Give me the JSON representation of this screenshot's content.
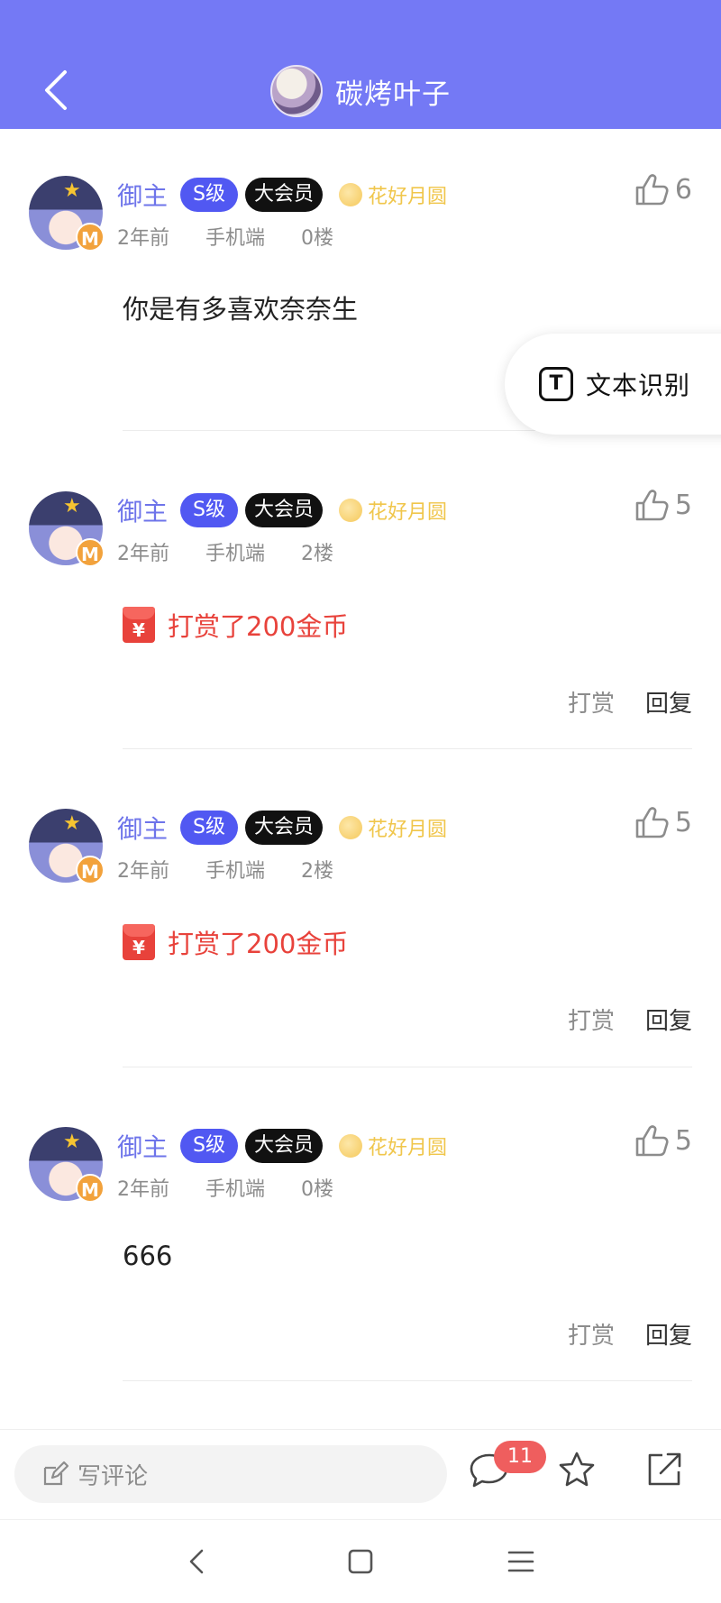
{
  "header": {
    "title": "碳烤叶子",
    "back_icon": "chevron-left-icon",
    "avatar_icon": "avatar"
  },
  "comments": [
    {
      "username": "御主",
      "level_tag": "S级",
      "vip_tag": "大会员",
      "title_badge": "花好月圆",
      "time": "2年前",
      "device": "手机端",
      "floor": "0楼",
      "likes": "6",
      "content": "你是有多喜欢奈奈生",
      "has_actions": false
    },
    {
      "username": "御主",
      "level_tag": "S级",
      "vip_tag": "大会员",
      "title_badge": "花好月圆",
      "time": "2年前",
      "device": "手机端",
      "floor": "2楼",
      "likes": "5",
      "reward_text": "打赏了200金币",
      "tip_label": "打赏",
      "reply_label": "回复"
    },
    {
      "username": "御主",
      "level_tag": "S级",
      "vip_tag": "大会员",
      "title_badge": "花好月圆",
      "time": "2年前",
      "device": "手机端",
      "floor": "2楼",
      "likes": "5",
      "reward_text": "打赏了200金币",
      "tip_label": "打赏",
      "reply_label": "回复"
    },
    {
      "username": "御主",
      "level_tag": "S级",
      "vip_tag": "大会员",
      "title_badge": "花好月圆",
      "time": "2年前",
      "device": "手机端",
      "floor": "0楼",
      "likes": "5",
      "content": "666",
      "tip_label": "打赏",
      "reply_label": "回复"
    }
  ],
  "ocr_button": {
    "label": "文本识别",
    "icon": "text-recognition-icon"
  },
  "bottom_bar": {
    "comment_placeholder": "写评论",
    "comment_count": "11",
    "icons": [
      "edit-icon",
      "comment-bubble-icon",
      "star-icon",
      "share-icon"
    ]
  },
  "system_nav": {
    "icons": [
      "back-icon",
      "home-icon",
      "menu-icon"
    ]
  },
  "colors": {
    "header_bg": "#7479f5",
    "username": "#6e74ea",
    "s_tag": "#5158f2",
    "reward": "#e8423b",
    "title_badge": "#f0c64b",
    "badge_red": "#ef5e5e"
  }
}
